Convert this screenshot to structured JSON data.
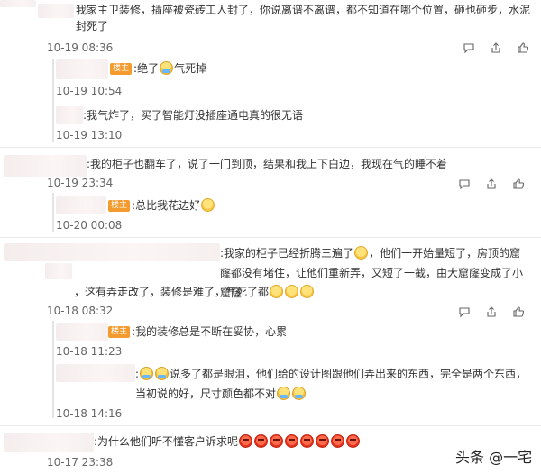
{
  "author_badge": "楼主",
  "watermark": "头条 @一宅",
  "comments": [
    {
      "text": "我家主卫装修，插座被瓷砖工人封了，你说离谱不离谱，都不知道在哪个位置，砸也砸步，水泥封死了",
      "time": "10-19 08:36",
      "replies": [
        {
          "is_author": true,
          "text": "绝了",
          "emoji": "cry",
          "text2": "气死掉",
          "time": "10-19 10:54"
        },
        {
          "is_author": false,
          "text": "我气炸了，买了智能灯没插座通电真的很无语",
          "time": "10-19 13:10"
        }
      ]
    },
    {
      "text": "我的柜子也翻车了，说了一门到顶，结果和我上下白边，我现在气的睡不着",
      "time": "10-19 23:34",
      "replies": [
        {
          "is_author": true,
          "text": "总比我花边好",
          "emoji": "laugh",
          "time": "10-20 00:08"
        }
      ]
    },
    {
      "text_parts": [
        "我家的柜子已经折腾三遍了",
        "，他们一开始量短了，房顶的窟窿都没有堵住，让他们重新弄，又短了一截，由大窟窿变成了小窟窿",
        "，这有弄走改了，装修是难了，气死了都"
      ],
      "time": "10-18 08:32",
      "replies": [
        {
          "is_author": true,
          "text": "我的装修总是不断在妥协，心累",
          "time": "10-18 11:23"
        },
        {
          "is_author": false,
          "text": "说多了都是眼泪，他们给的设计图跟他们弄出来的东西，完全是两个东西，当初说的好，尺寸颜色都不对",
          "time": "10-18 14:16"
        }
      ]
    },
    {
      "text": "为什么他们听不懂客户诉求呢",
      "time": "10-17 23:38"
    }
  ]
}
